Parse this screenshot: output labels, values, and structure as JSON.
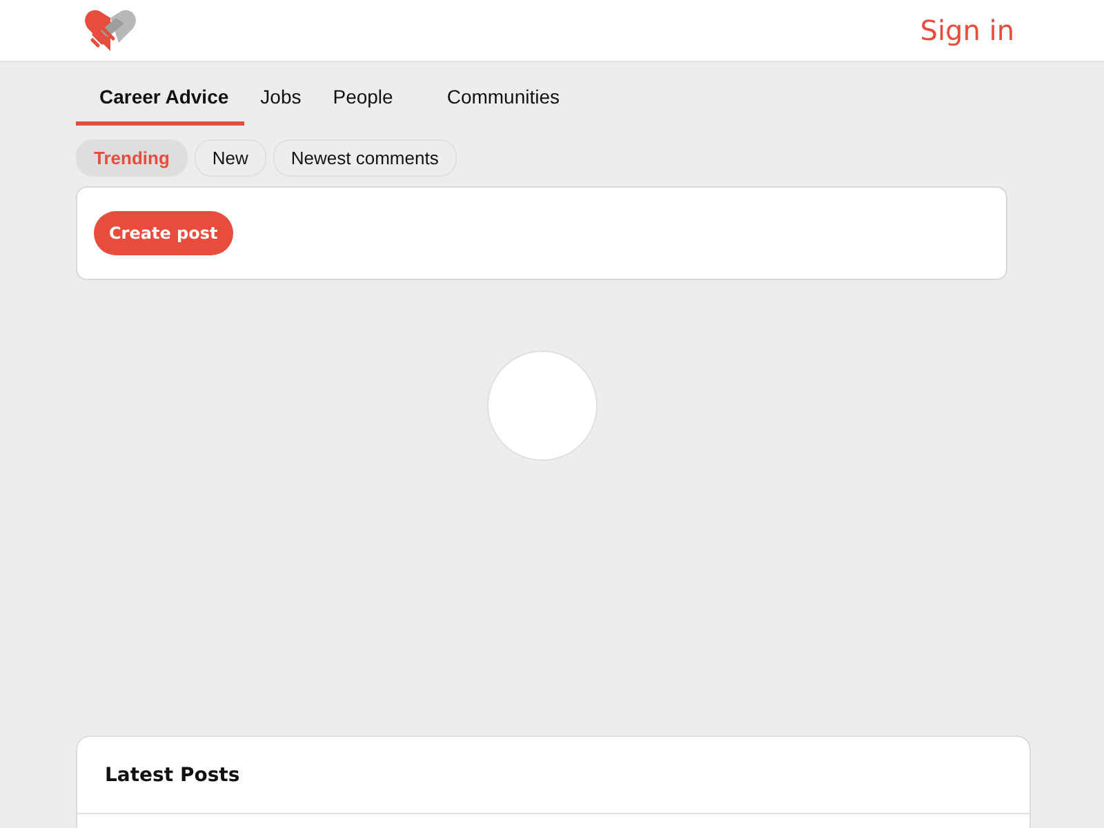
{
  "header": {
    "sign_in": "Sign in"
  },
  "tabs": [
    {
      "label": "Career Advice",
      "selected": true
    },
    {
      "label": "Jobs",
      "selected": false
    },
    {
      "label": "People",
      "selected": false
    },
    {
      "label": "Communities",
      "selected": false
    }
  ],
  "filters": [
    {
      "label": "Trending",
      "selected": true
    },
    {
      "label": "New",
      "selected": false
    },
    {
      "label": "Newest comments",
      "selected": false
    }
  ],
  "create_post": "Create post",
  "latest_posts": {
    "title": "Latest Posts"
  }
}
